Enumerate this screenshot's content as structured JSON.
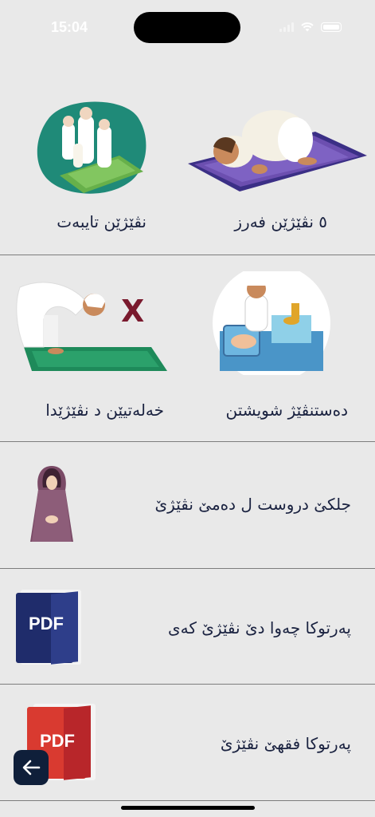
{
  "status_bar": {
    "time": "15:04"
  },
  "grid": {
    "row1": {
      "right_label": "٥ نڤێژێن فەرز",
      "left_label": "نڤێژێن تایبەت"
    },
    "row2": {
      "right_label": "دەستنڤێژ شویشتن",
      "left_label": "خەلەتیێن د نڤێژێدا",
      "x_mark": "X"
    }
  },
  "list": [
    {
      "label": "جلكێ دروست ل دەمێ نڤێژێ"
    },
    {
      "label": "پەرتوكا چەوا دێ نڤێژێ كەی",
      "pdf_text": "PDF"
    },
    {
      "label": "پەرتوكا فقهێ نڤێژێ",
      "pdf_text": "PDF"
    }
  ],
  "icons": [
    "signal-icon",
    "wifi-icon",
    "battery-icon",
    "back-arrow-icon"
  ],
  "colors": {
    "background": "#e9e9e9",
    "text": "#1a2240",
    "back_button": "#0f1f3a",
    "pdf_blue": "#1f2c6b",
    "pdf_red": "#d93a30",
    "x_mark": "#7a1a2e"
  }
}
